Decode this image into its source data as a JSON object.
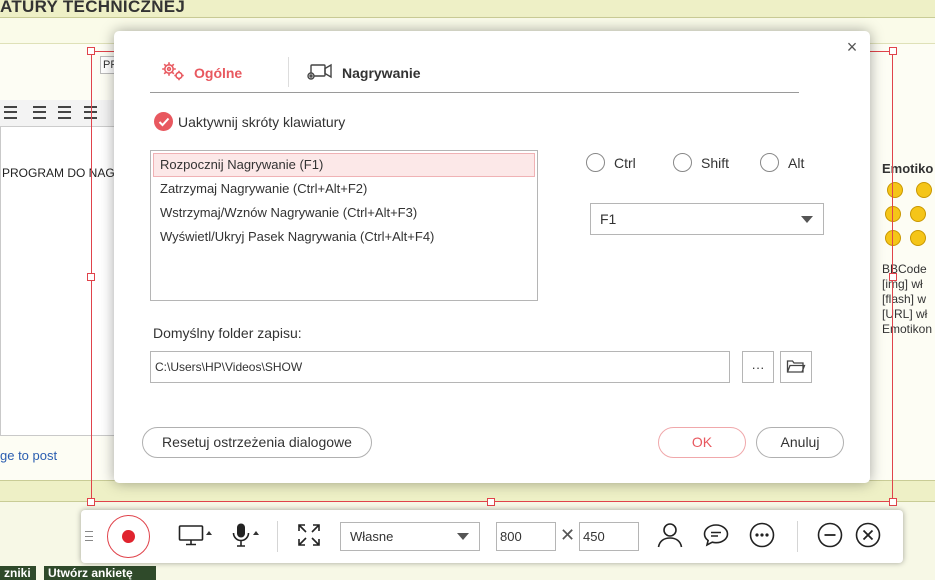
{
  "background": {
    "page_title": "ATURY TECHNICZNEJ",
    "prefix_text": "PF",
    "editor_text": "PROGRAM DO NAG",
    "link_text": "ge to post",
    "button_left": "zniki",
    "button_right": "Utwórz ankietę",
    "sidebar_title": "Emotiko",
    "bbcode_lines": [
      "BBCode",
      "[img] wł",
      "[flash] w",
      "[URL] wł",
      "Emotikon"
    ]
  },
  "dialog": {
    "tabs": [
      {
        "label": "Ogólne",
        "icon": "gears-icon",
        "active": true
      },
      {
        "label": "Nagrywanie",
        "icon": "camera-icon",
        "active": false
      }
    ],
    "enable_shortcuts_label": "Uaktywnij skróty klawiatury",
    "hotkeys": [
      "Rozpocznij Nagrywanie (F1)",
      "Zatrzymaj Nagrywanie (Ctrl+Alt+F2)",
      "Wstrzymaj/Wznów Nagrywanie (Ctrl+Alt+F3)",
      "Wyświetl/Ukryj Pasek Nagrywania (Ctrl+Alt+F4)"
    ],
    "modifiers": {
      "ctrl": "Ctrl",
      "shift": "Shift",
      "alt": "Alt"
    },
    "selected_key": "F1",
    "folder_label": "Domyślny folder zapisu:",
    "folder_path": "C:\\Users\\HP\\Videos\\SHOW",
    "browse_label": "···",
    "reset_label": "Resetuj ostrzeżenia dialogowe",
    "ok_label": "OK",
    "cancel_label": "Anuluj"
  },
  "recorder_bar": {
    "preset": "Własne",
    "width": "800",
    "height": "450",
    "times_symbol": "✕"
  },
  "colors": {
    "accent": "#e8585f",
    "record_red": "#e0242e",
    "frame_red": "#e0434b"
  }
}
